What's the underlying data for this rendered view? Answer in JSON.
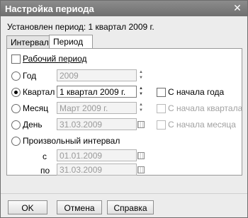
{
  "window": {
    "title": "Настройка периода",
    "close_glyph": "✕"
  },
  "status": {
    "text": "Установлен период: 1 квартал 2009 г."
  },
  "tabs": [
    {
      "label": "Интервал",
      "active": false
    },
    {
      "label": "Период",
      "active": true
    }
  ],
  "working_period": {
    "label": "Рабочий период",
    "checked": false
  },
  "options": {
    "year": {
      "label": "Год",
      "value": "2009",
      "selected": false
    },
    "quarter": {
      "label": "Квартал",
      "value": "1 квартал 2009 г.",
      "selected": true
    },
    "month": {
      "label": "Месяц",
      "value": "Март 2009 г.",
      "selected": false
    },
    "day": {
      "label": "День",
      "value": "31.03.2009",
      "selected": false
    },
    "custom": {
      "label": "Произвольный интервал",
      "selected": false,
      "from_label": "с",
      "from_value": "01.01.2009",
      "to_label": "по",
      "to_value": "31.03.2009"
    }
  },
  "side_checks": {
    "from_year_start": {
      "label": "С начала года",
      "checked": false,
      "enabled": true
    },
    "from_quarter_start": {
      "label": "С начала квартала",
      "checked": false,
      "enabled": false
    },
    "from_month_start": {
      "label": "С начала месяца",
      "checked": false,
      "enabled": false
    }
  },
  "buttons": {
    "ok": "OK",
    "cancel": "Отмена",
    "help": "Справка"
  },
  "colors": {
    "titlebar": "#7d7d7d",
    "dialog_bg": "#ececec",
    "panel_bg": "#ffffff",
    "disabled_text": "#a2a2a2"
  }
}
